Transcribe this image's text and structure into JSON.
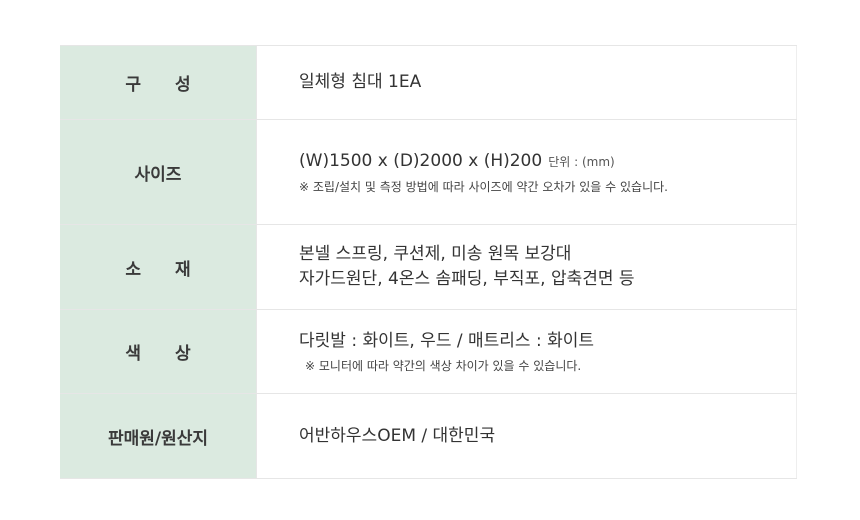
{
  "spec_table": {
    "rows": [
      {
        "label": "구 성",
        "lines": [
          "일체형 침대 1EA"
        ]
      },
      {
        "label": "사이즈",
        "main": "(W)1500 x (D)2000 x (H)200",
        "unit": "단위 : (mm)",
        "note": "※  조립/설치 및 측정 방법에 따라 사이즈에 약간 오차가 있을 수 있습니다."
      },
      {
        "label": "소 재",
        "lines": [
          "본넬 스프링, 쿠션제, 미송 원목 보강대",
          "자가드원단, 4온스 솜패딩, 부직포, 압축견면 등"
        ]
      },
      {
        "label": "색 상",
        "main": "다릿발 : 화이트, 우드 / 매트리스 : 화이트",
        "note": "※ 모니터에 따라 약간의 색상 차이가 있을 수 있습니다."
      },
      {
        "label": "판매원/원산지",
        "lines": [
          "어반하우스OEM / 대한민국"
        ]
      }
    ]
  }
}
